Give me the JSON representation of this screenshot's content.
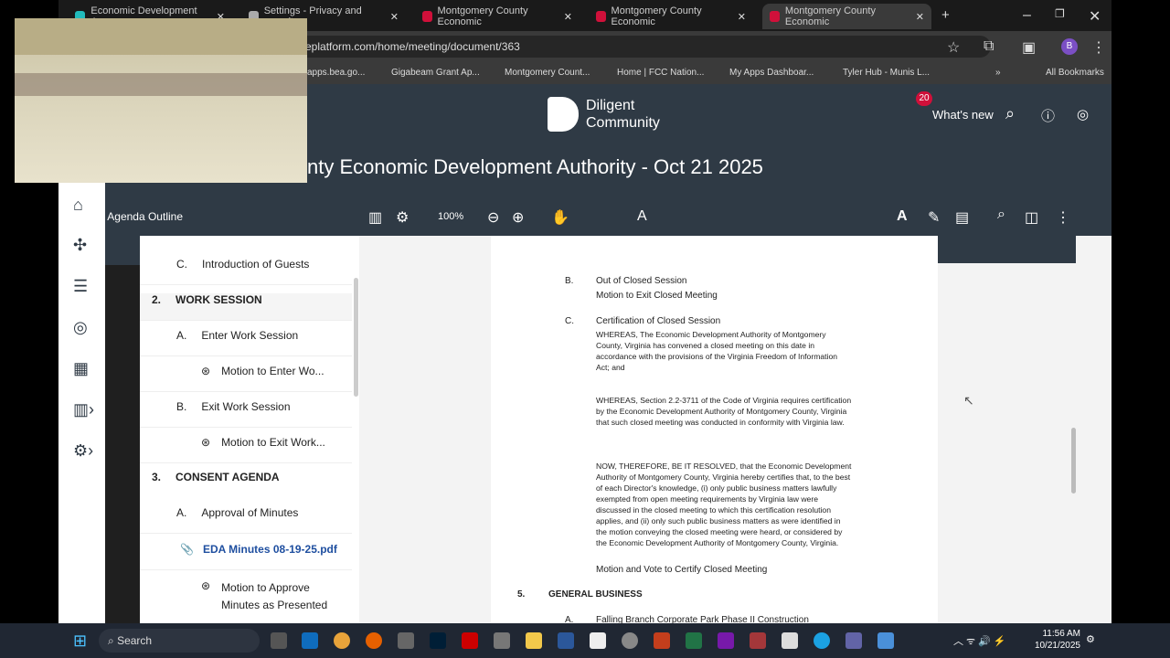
{
  "browser": {
    "tabs": [
      {
        "label": "Economic Development App"
      },
      {
        "label": "Settings - Privacy and security"
      },
      {
        "label": "Montgomery County Economic"
      },
      {
        "label": "Montgomery County Economic"
      },
      {
        "label": "Montgomery County Economic"
      }
    ],
    "url": "eplatform.com/home/meeting/document/363",
    "bookmarks": [
      "apps.bea.go...",
      "Gigabeam Grant Ap...",
      "Montgomery Count...",
      "Home | FCC Nation...",
      "My Apps Dashboar...",
      "Tyler Hub - Munis L...",
      "All Bookmarks"
    ],
    "profile": "B"
  },
  "header": {
    "logo_line1": "Diligent",
    "logo_line2": "Community",
    "notif_count": "20",
    "whats_new": "What's new"
  },
  "title": "nty Economic Development Authority - Oct 21 2025",
  "toolbar": {
    "outline_label": "Agenda Outline",
    "zoom": "100%"
  },
  "outline": [
    {
      "num": "C.",
      "label": "Introduction of Guests",
      "level": 2
    },
    {
      "num": "2.",
      "label": "WORK SESSION",
      "level": 1
    },
    {
      "num": "A.",
      "label": "Enter Work Session",
      "level": 2
    },
    {
      "num": "",
      "label": "Motion to Enter Wo...",
      "level": 3,
      "type": "motion"
    },
    {
      "num": "B.",
      "label": "Exit Work Session",
      "level": 2
    },
    {
      "num": "",
      "label": "Motion to Exit Work...",
      "level": 3,
      "type": "motion"
    },
    {
      "num": "3.",
      "label": "CONSENT AGENDA",
      "level": 1
    },
    {
      "num": "A.",
      "label": "Approval of Minutes",
      "level": 2
    },
    {
      "num": "",
      "label": "EDA Minutes 08-19-25.pdf",
      "level": 3,
      "type": "file"
    },
    {
      "num": "",
      "label": "Motion to Approve Minutes as Presented",
      "level": 3,
      "type": "motion"
    }
  ],
  "document": {
    "b_num": "B.",
    "b_title": "Out of Closed Session",
    "b_motion": "Motion to Exit Closed Meeting",
    "c_num": "C.",
    "c_title": "Certification of Closed Session",
    "p1": "WHEREAS, The Economic Development Authority of Montgomery County, Virginia has convened a closed meeting on this date in accordance with the provisions of the Virginia Freedom of Information Act; and",
    "p2": "WHEREAS, Section 2.2-3711 of the Code of Virginia requires certification by the Economic Development Authority of Montgomery County, Virginia that such closed meeting was conducted in conformity with Virginia law.",
    "p3": "NOW, THEREFORE, BE IT RESOLVED, that the Economic Development Authority of Montgomery County, Virginia hereby certifies that, to the best of each Director's knowledge, (i) only public business matters lawfully exempted from open meeting requirements by Virginia law were discussed in the closed meeting to which this certification resolution applies, and (ii) only such public business matters as were identified in the motion conveying the closed meeting were heard, or considered by the Economic Development Authority of Montgomery County, Virginia.",
    "c_motion": "Motion and Vote to Certify Closed Meeting",
    "s5_num": "5.",
    "s5_title": "GENERAL BUSINESS",
    "a_num": "A.",
    "a_title": "Falling Branch Corporate Park Phase II Construction"
  },
  "taskbar": {
    "search": "Search",
    "time": "11:56 AM",
    "date": "10/21/2025"
  }
}
